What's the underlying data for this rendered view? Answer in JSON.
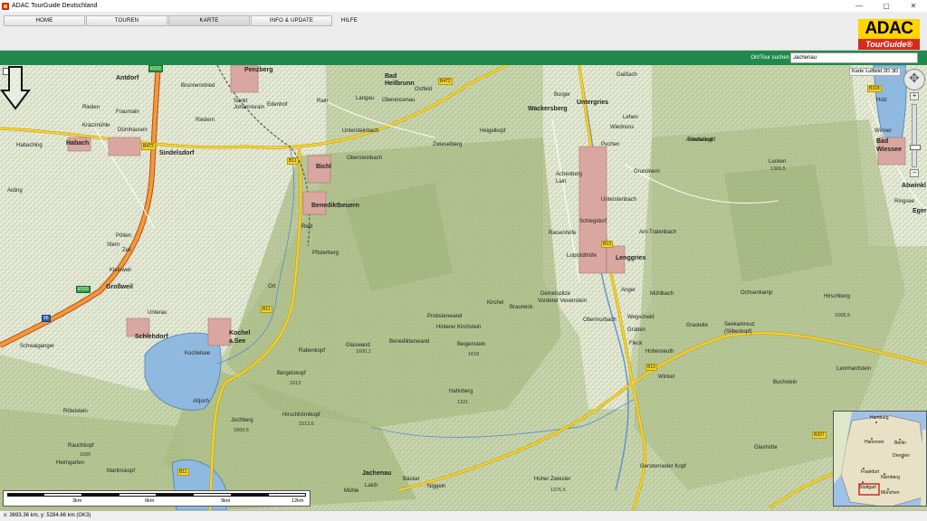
{
  "window": {
    "title": "ADAC TourGuide Deutschland",
    "controls": [
      "—",
      "▢",
      "✕"
    ]
  },
  "tabs": [
    {
      "label": "HOME"
    },
    {
      "label": "TOUREN"
    },
    {
      "label": "KARTE"
    },
    {
      "label": "INFO & UPDATE"
    },
    {
      "label": "HILFE"
    }
  ],
  "logo": {
    "top": "ADAC",
    "bottom": "TourGuide®"
  },
  "search": {
    "label": "Ort/Tour suchen",
    "value": "Jachenau"
  },
  "map_type": {
    "options": [
      "Karte",
      "Luftbild",
      "2D",
      "3D"
    ]
  },
  "scale": {
    "labels": [
      "3km",
      "6km",
      "9km",
      "12km"
    ]
  },
  "overview": {
    "labels": [
      "Hamburg",
      "Hannover",
      "Berlin",
      "Dresden",
      "Frankfurt",
      "Nürnberg",
      "Stuttgart",
      "München"
    ]
  },
  "status": {
    "coords": "x: 3693.36 km, y: 5284.66 km (GK3)"
  },
  "map": {
    "places": [
      {
        "t": "Penzberg",
        "b": true
      },
      {
        "t": "Antdorf",
        "b": true
      },
      {
        "t": "Bad Heilbrunn",
        "b": true
      },
      {
        "t": "Habach",
        "b": true
      },
      {
        "t": "Sindelsdorf",
        "b": true
      },
      {
        "t": "Bichl",
        "b": true
      },
      {
        "t": "Benediktbeuern",
        "b": true
      },
      {
        "t": "Wackersberg",
        "b": true
      },
      {
        "t": "Untergries",
        "b": true
      },
      {
        "t": "Lenggries",
        "b": true
      },
      {
        "t": "Großweil",
        "b": true
      },
      {
        "t": "Schlehdorf",
        "b": true
      },
      {
        "t": "Kochel a.See",
        "b": true
      },
      {
        "t": "Jachenau",
        "b": true
      },
      {
        "t": "Bad Wiessee",
        "b": true
      },
      {
        "t": "Abwinkl",
        "b": true
      },
      {
        "t": "Brunnenstried"
      },
      {
        "t": "Sankt Johannisrain"
      },
      {
        "t": "Edenhof"
      },
      {
        "t": "Fraunrain"
      },
      {
        "t": "Rieden"
      },
      {
        "t": "Kratzmühle"
      },
      {
        "t": "Dürnhausen"
      },
      {
        "t": "Riedern"
      },
      {
        "t": "Langau"
      },
      {
        "t": "Oberenzenau"
      },
      {
        "t": "Ostfeld"
      },
      {
        "t": "Rain"
      },
      {
        "t": "Untersteinbach"
      },
      {
        "t": "Obersteinbach"
      },
      {
        "t": "Habaching"
      },
      {
        "t": "Aiding"
      },
      {
        "t": "Ried"
      },
      {
        "t": "Pölten"
      },
      {
        "t": "Zell"
      },
      {
        "t": "Stern"
      },
      {
        "t": "Kleinweil"
      },
      {
        "t": "Pfisterberg"
      },
      {
        "t": "Ort"
      },
      {
        "t": "Unterau"
      },
      {
        "t": "Schwaiganger"
      },
      {
        "t": "Kochelsee"
      },
      {
        "t": "Altjoch"
      },
      {
        "t": "Heimgarten"
      },
      {
        "t": "Martinskopf"
      },
      {
        "t": "Röteistein"
      },
      {
        "t": "Rauchkopf"
      },
      {
        "t": "Jochberg"
      },
      {
        "t": "Hirschhörnlkopf"
      },
      {
        "t": "Glaswand"
      },
      {
        "t": "Rabenkopf"
      },
      {
        "t": "Bergelskopf"
      },
      {
        "t": "Benediktenwand"
      },
      {
        "t": "Probstenwand"
      },
      {
        "t": "Hinterer Kirchstein"
      },
      {
        "t": "Beigenstein"
      },
      {
        "t": "Kirchel"
      },
      {
        "t": "Brauneck"
      },
      {
        "t": "Demelspitze"
      },
      {
        "t": "Vorderer Vexenstein"
      },
      {
        "t": "Achelskopf"
      },
      {
        "t": "Hahnberg"
      },
      {
        "t": "Zwieselberg"
      },
      {
        "t": "Heigelkopf"
      },
      {
        "t": "Burger"
      },
      {
        "t": "Wegscheid"
      },
      {
        "t": "Mühlbach"
      },
      {
        "t": "Graben"
      },
      {
        "t": "Fleck"
      },
      {
        "t": "Hohenreuth"
      },
      {
        "t": "Winkel"
      },
      {
        "t": "Gerstenrieder Kopf"
      },
      {
        "t": "Hoher Zwiesler"
      },
      {
        "t": "Ochsenkamp"
      },
      {
        "t": "Seekarkreuz (Silberkopf)"
      },
      {
        "t": "Grasleite"
      },
      {
        "t": "Leonhardstein"
      },
      {
        "t": "Buchstein"
      },
      {
        "t": "Hirschberg"
      },
      {
        "t": "Rechelkopf"
      },
      {
        "t": "Lucken"
      },
      {
        "t": "Holz"
      },
      {
        "t": "Winner"
      },
      {
        "t": "Gaißach"
      },
      {
        "t": "Lehen"
      },
      {
        "t": "Wiednoss"
      },
      {
        "t": "Puchen"
      },
      {
        "t": "Grundnern"
      },
      {
        "t": "Unterstenbach"
      },
      {
        "t": "Am-Tratenbach"
      },
      {
        "t": "Riesenhöfe"
      },
      {
        "t": "Anger"
      },
      {
        "t": "Obermurbach"
      },
      {
        "t": "Achenberg"
      },
      {
        "t": "Lain"
      },
      {
        "t": "Schlegldorf"
      },
      {
        "t": "Lutpoldthöfe"
      },
      {
        "t": "Glashütte"
      },
      {
        "t": "Mühle"
      },
      {
        "t": "Laich"
      },
      {
        "t": "Bäcker"
      },
      {
        "t": "Niggeln"
      },
      {
        "t": "Ringsee"
      },
      {
        "t": "Eger"
      }
    ],
    "roads": [
      "E533",
      "B472",
      "B472",
      "B11",
      "B11",
      "B13",
      "B13",
      "B307",
      "B318",
      "B11",
      "E533",
      "95"
    ],
    "peaks": [
      "1669,5",
      "1618",
      "1613",
      "1513,6",
      "1600",
      "1321",
      "1376,5",
      "1369,5",
      "1668,9",
      "1600,1"
    ]
  }
}
